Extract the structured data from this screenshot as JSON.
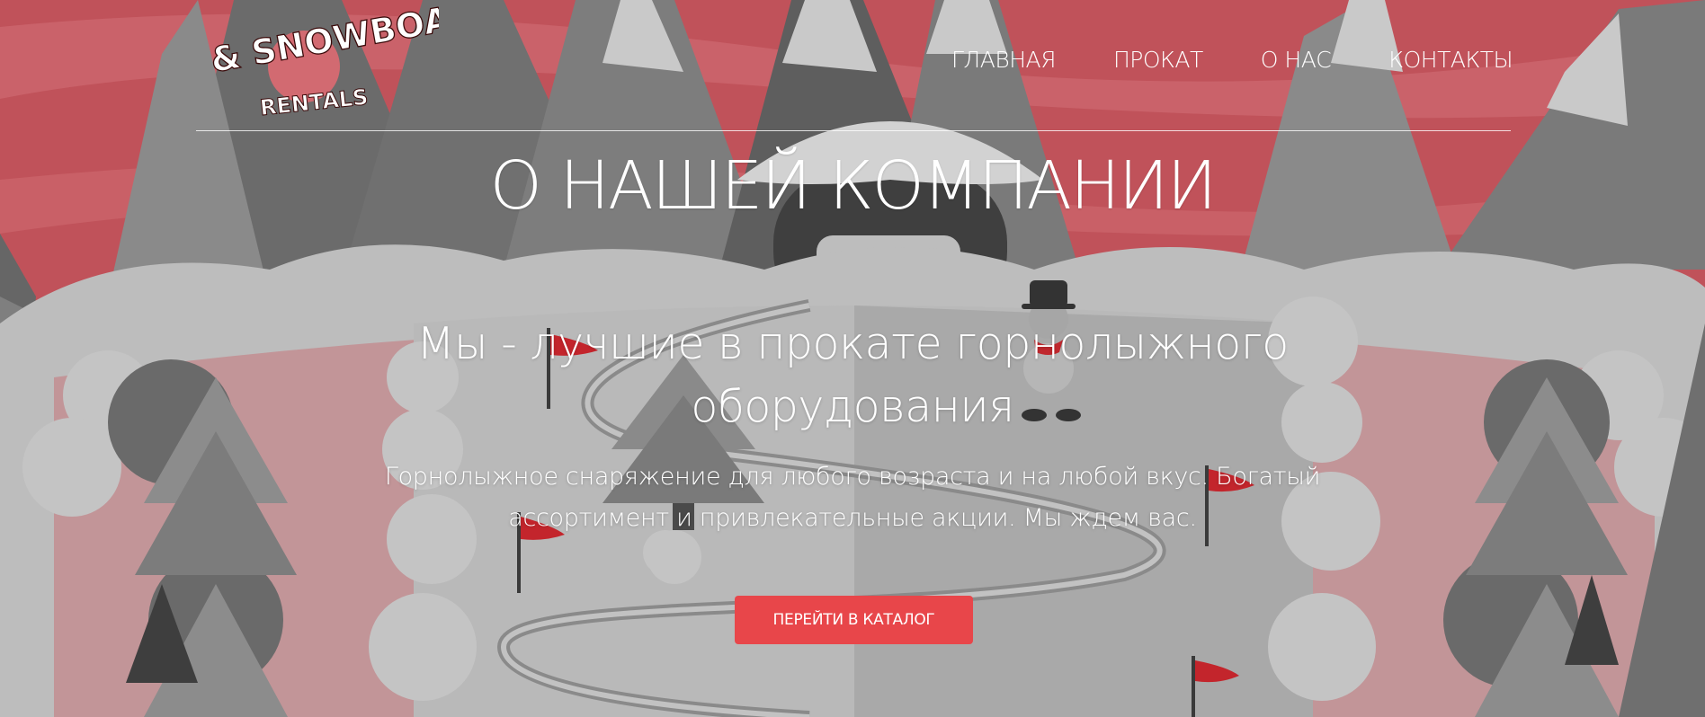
{
  "header": {
    "logo": {
      "line1": "SKI & SNOWBOARD",
      "line2": "RENTALS"
    },
    "nav": [
      {
        "label": "ГЛАВНАЯ"
      },
      {
        "label": "ПРОКАТ"
      },
      {
        "label": "О НАС"
      },
      {
        "label": "КОНТАКТЫ"
      }
    ]
  },
  "hero": {
    "title": "О НАШЕЙ КОМПАНИИ",
    "headline": "Мы - лучшие в прокате горнолыжного оборудования",
    "description": "Горнолыжное снаряжение для любого возраста и на любой вкус. Богатый ассортимент и привлекательные акции. Мы ждем вас.",
    "cta_label": "ПЕРЕЙТИ В КАТАЛОГ"
  },
  "colors": {
    "sky": "#c2515a",
    "sky_stripe": "#d27073",
    "accent": "#e8464a",
    "snow": "#bdbdbd",
    "pink_field": "#c29598"
  },
  "icons": [
    "mountain-icon",
    "tree-icon",
    "snowman-icon",
    "flag-icon",
    "hut-icon"
  ]
}
